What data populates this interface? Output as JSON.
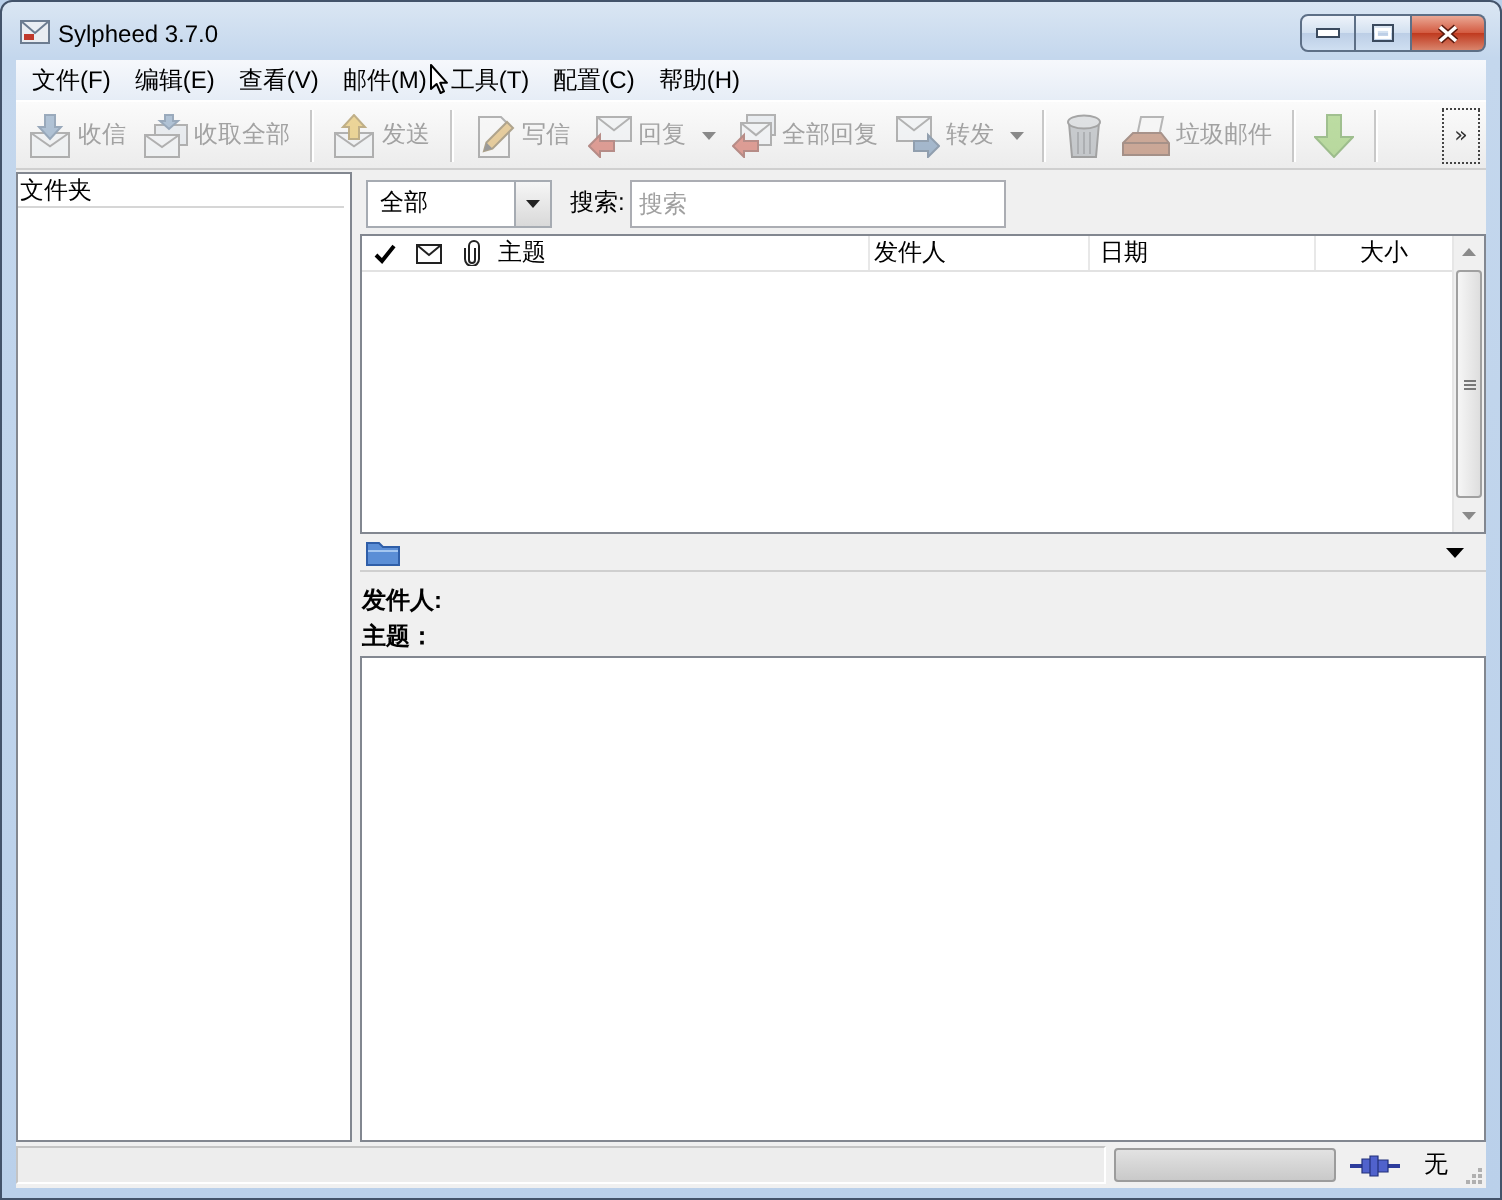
{
  "window": {
    "title": "Sylpheed 3.7.0"
  },
  "menu": [
    "文件(F)",
    "编辑(E)",
    "查看(V)",
    "邮件(M)",
    "工具(T)",
    "配置(C)",
    "帮助(H)"
  ],
  "toolbar": {
    "items": [
      {
        "kind": "button",
        "label": "收信",
        "disabled": true,
        "dropdown": false
      },
      {
        "kind": "button",
        "label": "收取全部",
        "disabled": true,
        "dropdown": false
      },
      {
        "kind": "separator"
      },
      {
        "kind": "button",
        "label": "发送",
        "disabled": true,
        "dropdown": false
      },
      {
        "kind": "separator"
      },
      {
        "kind": "button",
        "label": "写信",
        "disabled": true,
        "dropdown": false
      },
      {
        "kind": "button",
        "label": "回复",
        "disabled": true,
        "dropdown": true
      },
      {
        "kind": "button",
        "label": "全部回复",
        "disabled": true,
        "dropdown": false
      },
      {
        "kind": "button",
        "label": "转发",
        "disabled": true,
        "dropdown": true
      },
      {
        "kind": "separator"
      },
      {
        "kind": "icon",
        "disabled": true,
        "dropdown": false
      },
      {
        "kind": "button",
        "label": "垃圾邮件",
        "disabled": true,
        "dropdown": false
      },
      {
        "kind": "separator"
      },
      {
        "kind": "icon",
        "disabled": true,
        "dropdown": false
      },
      {
        "kind": "separator"
      }
    ],
    "overflow": "»"
  },
  "folder_pane": {
    "header": "文件夹"
  },
  "summary": {
    "filter": {
      "value": "全部"
    },
    "search_label": "搜索:",
    "search": {
      "placeholder": "搜索"
    },
    "columns": [
      "主题",
      "发件人",
      "日期",
      "大小"
    ]
  },
  "message_view": {
    "headers": [
      "发件人:",
      "主题："
    ]
  },
  "status_bar": {
    "progress": {
      "level": 0
    },
    "account": "无"
  }
}
